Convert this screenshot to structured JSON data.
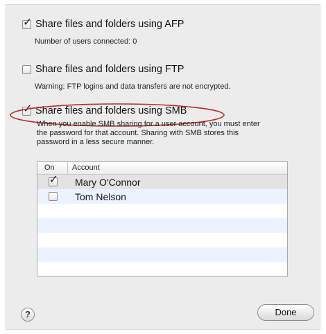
{
  "options": {
    "afp": {
      "label": "Share files and folders using AFP",
      "checked": true,
      "note": "Number of users connected: 0"
    },
    "ftp": {
      "label": "Share files and folders using FTP",
      "checked": false,
      "note": "Warning: FTP logins and data transfers are not encrypted."
    },
    "smb": {
      "label": "Share files and folders using SMB",
      "checked": true,
      "description": [
        "When you enable SMB sharing for a user account, you must enter",
        "the password for that account. Sharing with SMB stores this",
        "password in a less secure manner."
      ]
    }
  },
  "accounts_table": {
    "columns": [
      "On",
      "Account"
    ],
    "rows": [
      {
        "name": "Mary O'Connor",
        "on": true
      },
      {
        "name": "Tom Nelson",
        "on": false
      }
    ]
  },
  "buttons": {
    "help": "?",
    "done": "Done"
  },
  "annotation_color": "#c0272d",
  "tick": "✓"
}
